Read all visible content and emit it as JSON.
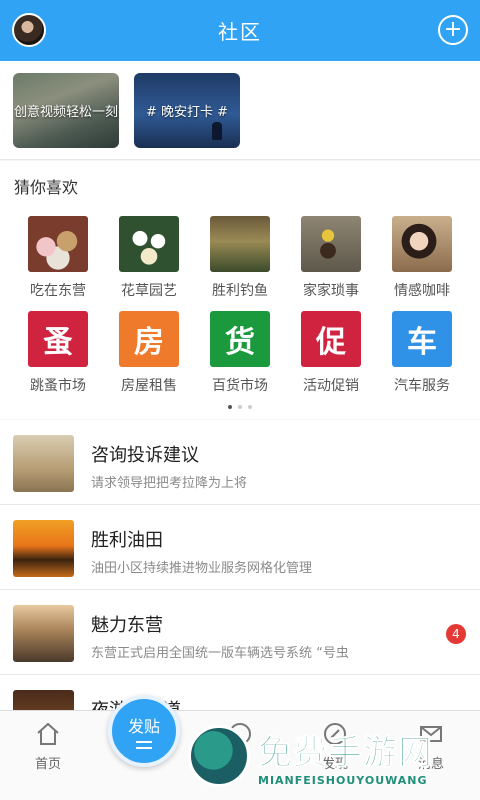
{
  "header": {
    "title": "社区"
  },
  "banners": [
    {
      "text": "创意视频轻松一刻"
    },
    {
      "text": "# 晚安打卡 #"
    }
  ],
  "guess": {
    "title": "猜你喜欢",
    "row1": [
      {
        "label": "吃在东营",
        "icon": "food-photo"
      },
      {
        "label": "花草园艺",
        "icon": "flower-photo"
      },
      {
        "label": "胜利钓鱼",
        "icon": "fishing-photo"
      },
      {
        "label": "家家琐事",
        "icon": "toy-photo"
      },
      {
        "label": "情感咖啡",
        "icon": "girl-photo"
      }
    ],
    "row2": [
      {
        "label": "跳蚤市场",
        "glyph": "蚤",
        "color": "#d0233f"
      },
      {
        "label": "房屋租售",
        "glyph": "房",
        "color": "#f07a2b"
      },
      {
        "label": "百货市场",
        "glyph": "货",
        "color": "#1a9a3c"
      },
      {
        "label": "活动促销",
        "glyph": "促",
        "color": "#d0233f"
      },
      {
        "label": "汽车服务",
        "glyph": "车",
        "color": "#2f92e6"
      }
    ]
  },
  "feed": [
    {
      "title": "咨询投诉建议",
      "subtitle": "请求领导把把考拉降为上将"
    },
    {
      "title": "胜利油田",
      "subtitle": "油田小区持续推进物业服务网格化管理"
    },
    {
      "title": "魅力东营",
      "subtitle": "东营正式启用全国统一版车辆选号系统 “号虫",
      "badge": "4"
    },
    {
      "title": "夜游东营道",
      "subtitle": ""
    }
  ],
  "tabbar": {
    "home": "首页",
    "post": "发贴",
    "circle": "圈",
    "discover": "发现",
    "message": "消息"
  },
  "watermark": {
    "cn": "免费手游网",
    "en": "MIANFEISHOUYOUWANG"
  }
}
